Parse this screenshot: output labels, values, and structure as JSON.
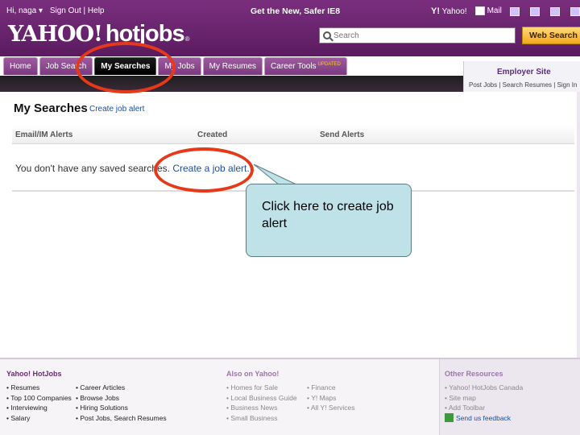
{
  "header": {
    "greeting": "Hi, naga ▾",
    "sign_out": "Sign Out",
    "help": "Help",
    "promo": "Get the New, Safer IE8",
    "yahoo_link": "Yahoo!",
    "mail_link": "Mail",
    "logo_yahoo": "YAHOO!",
    "logo_hotjobs": "hotjobs",
    "logo_reg": "®",
    "search_placeholder": "Search",
    "web_search_label": "Web Search"
  },
  "tabs": [
    {
      "label": "Home",
      "active": false
    },
    {
      "label": "Job Search",
      "active": false
    },
    {
      "label": "My Searches",
      "active": true
    },
    {
      "label": "My Jobs",
      "active": false
    },
    {
      "label": "My Resumes",
      "active": false
    },
    {
      "label": "Career Tools",
      "active": false,
      "badge": "UPDATED"
    }
  ],
  "employer": {
    "title": "Employer Site",
    "links": "Post Jobs | Search Resumes | Sign In"
  },
  "main": {
    "title": "My Searches",
    "create_link": "Create job alert",
    "columns": [
      "Email/IM Alerts",
      "Created",
      "Send Alerts"
    ],
    "empty_text": "You don't have any saved searches.",
    "empty_link": "Create a job alert."
  },
  "callout": {
    "text": "Click here to create job alert"
  },
  "footer": {
    "col1_title": "Yahoo! HotJobs",
    "col1a": [
      "Resumes",
      "Top 100 Companies",
      "Interviewing",
      "Salary"
    ],
    "col1b": [
      "Career Articles",
      "Browse Jobs",
      "Hiring Solutions",
      "Post Jobs, Search Resumes"
    ],
    "col2_title": "Also on Yahoo!",
    "col2a": [
      "Homes for Sale",
      "Local Business Guide",
      "Business News",
      "Small Business"
    ],
    "col2b": [
      "Finance",
      "Y! Maps",
      "All Y! Services"
    ],
    "col3_title": "Other Resources",
    "col3": [
      "Yahoo! HotJobs Canada",
      "Site map",
      "Add Toolbar"
    ],
    "feedback": "Send us feedback"
  },
  "colors": {
    "header_purple": "#5b1b60",
    "accent_red": "#e53919",
    "link_blue": "#1a4fa0",
    "callout_fill": "#bfe2e8"
  }
}
